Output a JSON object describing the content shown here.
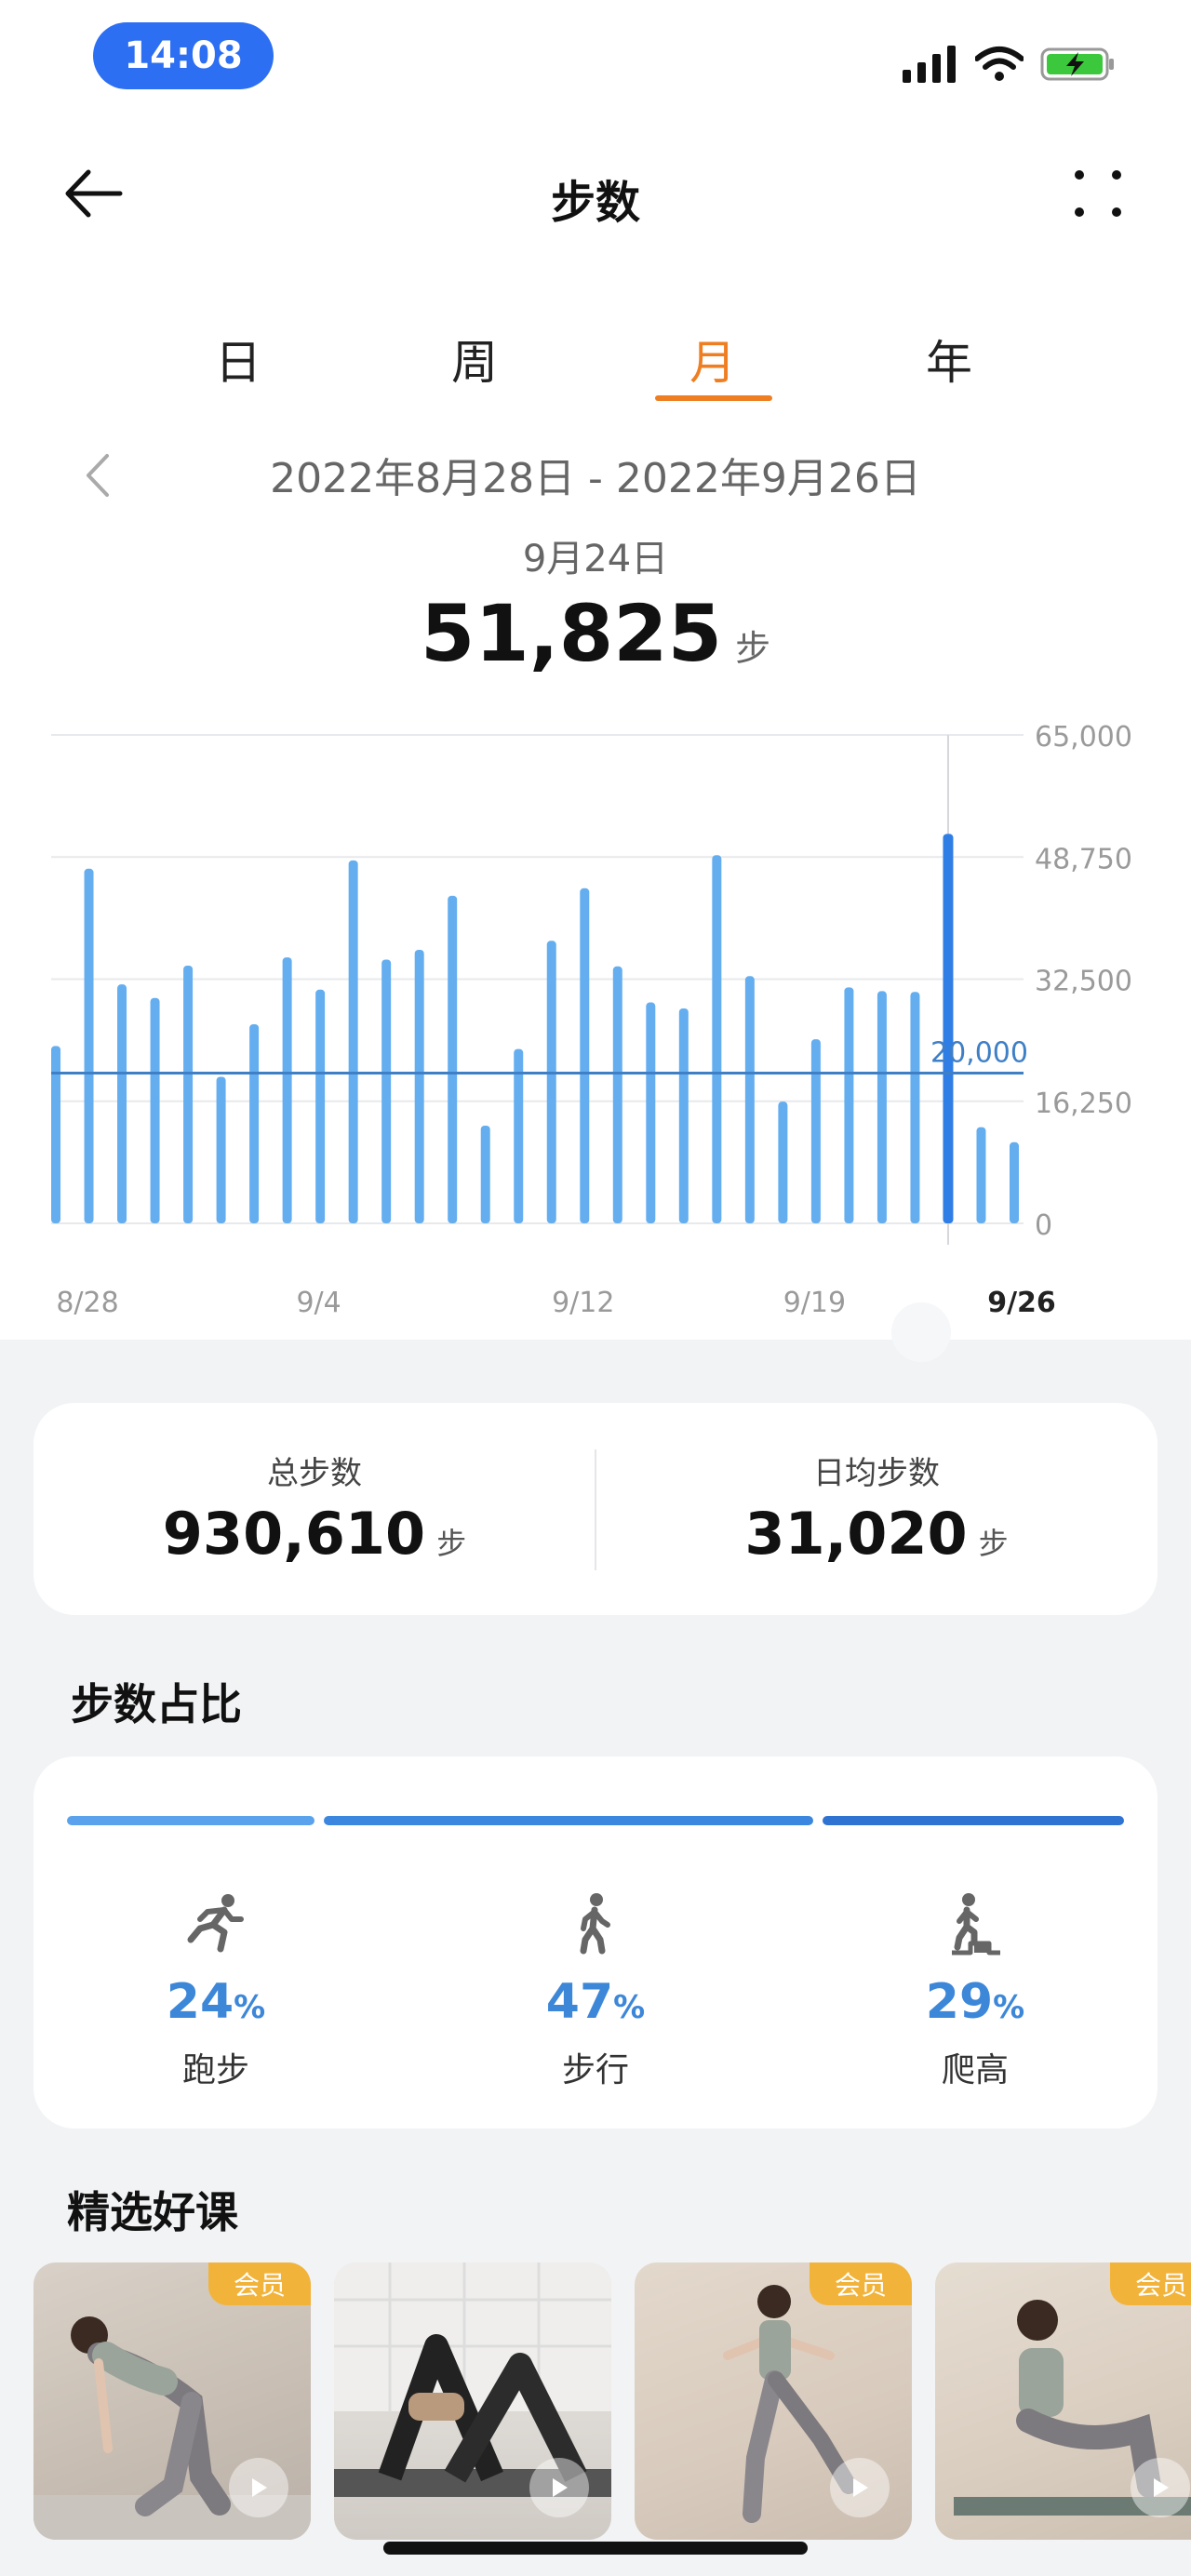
{
  "status_bar": {
    "time": "14:08"
  },
  "header": {
    "title": "步数"
  },
  "tabs": [
    {
      "label": "日"
    },
    {
      "label": "周"
    },
    {
      "label": "月"
    },
    {
      "label": "年"
    }
  ],
  "date_range": "2022年8月28日 - 2022年9月26日",
  "selected": {
    "date": "9月24日",
    "value": "51,825",
    "unit": "步"
  },
  "chart_data": {
    "type": "bar",
    "categories": [
      "8/28",
      "8/29",
      "8/30",
      "8/31",
      "9/1",
      "9/2",
      "9/3",
      "9/4",
      "9/5",
      "9/6",
      "9/7",
      "9/8",
      "9/9",
      "9/10",
      "9/11",
      "9/12",
      "9/13",
      "9/14",
      "9/15",
      "9/16",
      "9/17",
      "9/18",
      "9/19",
      "9/20",
      "9/21",
      "9/22",
      "9/23",
      "9/24",
      "9/25",
      "9/26"
    ],
    "values": [
      23600,
      47200,
      31800,
      30000,
      34300,
      19500,
      26500,
      35400,
      31100,
      48300,
      35100,
      36400,
      43600,
      13000,
      23200,
      37600,
      44600,
      34200,
      29400,
      28600,
      49000,
      32900,
      16200,
      24500,
      31400,
      30900,
      30800,
      51825,
      12800,
      10800
    ],
    "x_tick_labels": [
      "8/28",
      "9/4",
      "9/12",
      "9/19",
      "9/26"
    ],
    "y_tick_labels": [
      "65,000",
      "48,750",
      "32,500",
      "16,250",
      "0"
    ],
    "ylim": [
      0,
      65000
    ],
    "target_line": {
      "value": 20000,
      "label": "20,000"
    },
    "selected_category": "9/24",
    "grid": true,
    "colors": {
      "bar": "#64aef0",
      "selected_bar": "#2f7ee6",
      "target_line": "#3f7fc6",
      "grid": "#e8e9ec",
      "tick": "#9a9a9a"
    }
  },
  "summary": {
    "total": {
      "label": "总步数",
      "value": "930,610",
      "unit": "步"
    },
    "average": {
      "label": "日均步数",
      "value": "31,020",
      "unit": "步"
    }
  },
  "ratio": {
    "title": "步数占比",
    "items": [
      {
        "icon": "running-icon",
        "percent": "24",
        "percent_sign": "%",
        "label": "跑步",
        "bar_color": "#5aa2ec"
      },
      {
        "icon": "walking-icon",
        "percent": "47",
        "percent_sign": "%",
        "label": "步行",
        "bar_color": "#3b86de"
      },
      {
        "icon": "climbing-icon",
        "percent": "29",
        "percent_sign": "%",
        "label": "爬高",
        "bar_color": "#2f73d2"
      }
    ]
  },
  "courses": {
    "title": "精选好课",
    "items": [
      {
        "badge": "会员"
      },
      {
        "badge": ""
      },
      {
        "badge": "会员"
      },
      {
        "badge": "会员"
      }
    ]
  },
  "colors": {
    "accent_orange": "#ef7e22",
    "status_pill": "#2d6ff2",
    "battery_green": "#3cc83c"
  }
}
